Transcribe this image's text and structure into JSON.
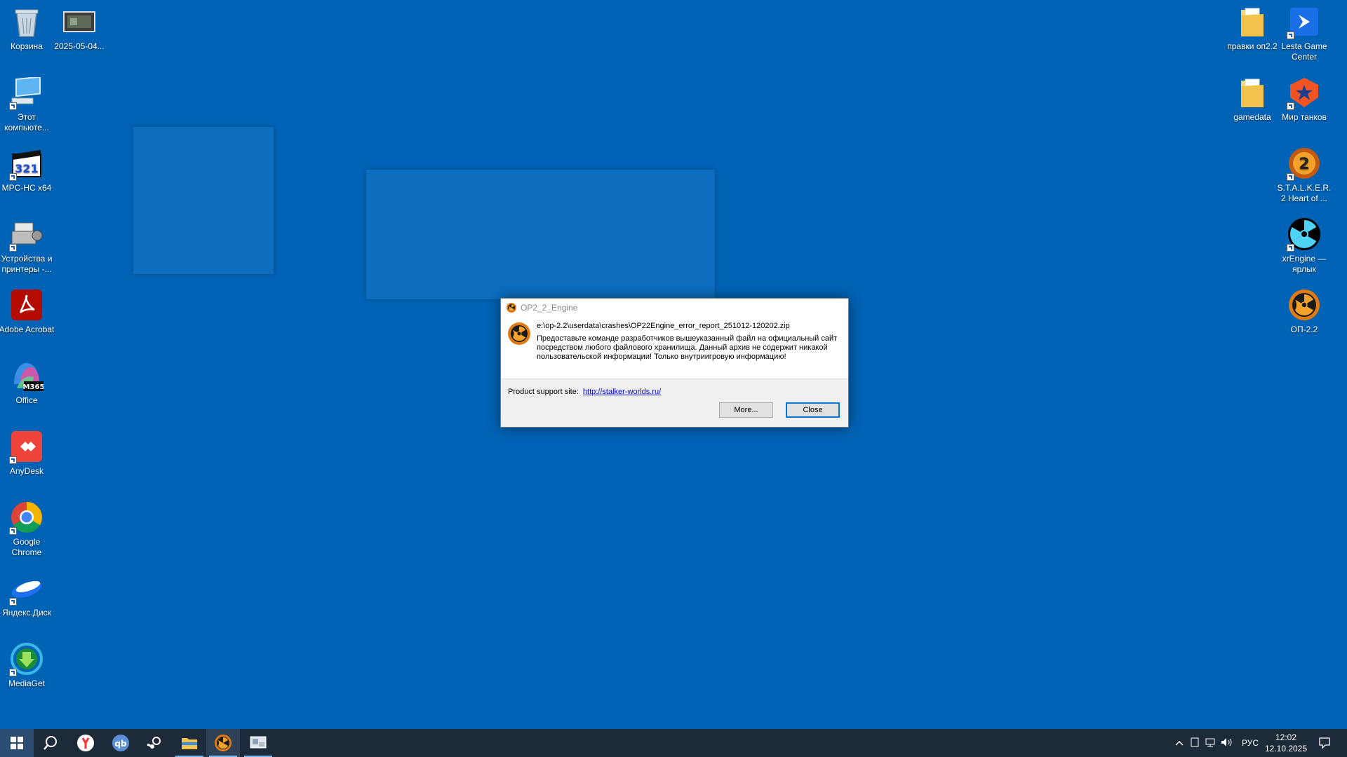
{
  "desktop": {
    "icons_left": [
      {
        "label": "Корзина",
        "icon": "recycle-bin-icon"
      },
      {
        "label": "2025-05-04...",
        "icon": "image-file-icon"
      },
      {
        "label": "Этот компьюте...",
        "icon": "this-pc-icon"
      },
      {
        "label": "MPC-HC x64",
        "icon": "mpc-hc-icon"
      },
      {
        "label": "Устройства и принтеры -...",
        "icon": "printer-icon"
      },
      {
        "label": "Adobe Acrobat",
        "icon": "acrobat-icon"
      },
      {
        "label": "Office",
        "icon": "office-icon",
        "badge": "M365"
      },
      {
        "label": "AnyDesk",
        "icon": "anydesk-icon"
      },
      {
        "label": "Google Chrome",
        "icon": "chrome-icon"
      },
      {
        "label": "Яндекс.Диск",
        "icon": "yandex-disk-icon"
      },
      {
        "label": "MediaGet",
        "icon": "mediaget-icon"
      }
    ],
    "icons_right": [
      {
        "label": "правки оп2.2",
        "icon": "folder-icon"
      },
      {
        "label": "Lesta Game Center",
        "icon": "lesta-icon"
      },
      {
        "label": "gamedata",
        "icon": "folder-icon"
      },
      {
        "label": "Мир танков",
        "icon": "mir-tankov-icon"
      },
      {
        "label": "S.T.A.L.K.E.R. 2 Heart of ...",
        "icon": "stalker2-icon"
      },
      {
        "label": "xrEngine — ярлык",
        "icon": "radiation-icon"
      },
      {
        "label": "ОП-2.2",
        "icon": "op22-icon"
      }
    ]
  },
  "dialog": {
    "title": "OP2_2_Engine",
    "path": "e:\\op-2.2\\userdata\\crashes\\OP22Engine_error_report_251012-120202.zip",
    "message": "Предоставьте команде разработчиков вышеуказанный файл на официальный сайт посредством любого файлового хранилища. Данный архив не содержит никакой пользовательской информации! Только внутриигровую информацию!",
    "support_label": "Product support site:",
    "support_link": "http://stalker-worlds.ru/",
    "more_button": "More...",
    "close_button": "Close"
  },
  "taskbar": {
    "items": [
      "start-icon",
      "search-icon",
      "yandex-browser-icon",
      "qbittorrent-icon",
      "steam-icon",
      "file-explorer-icon",
      "op22-engine-icon",
      "crash-reporter-icon"
    ],
    "lang": "РУС",
    "time": "12:02",
    "date": "12.10.2025"
  },
  "colors": {
    "desktop": "#0063b5",
    "taskbar": "#1c2a3a",
    "accent": "#76b9ed"
  }
}
